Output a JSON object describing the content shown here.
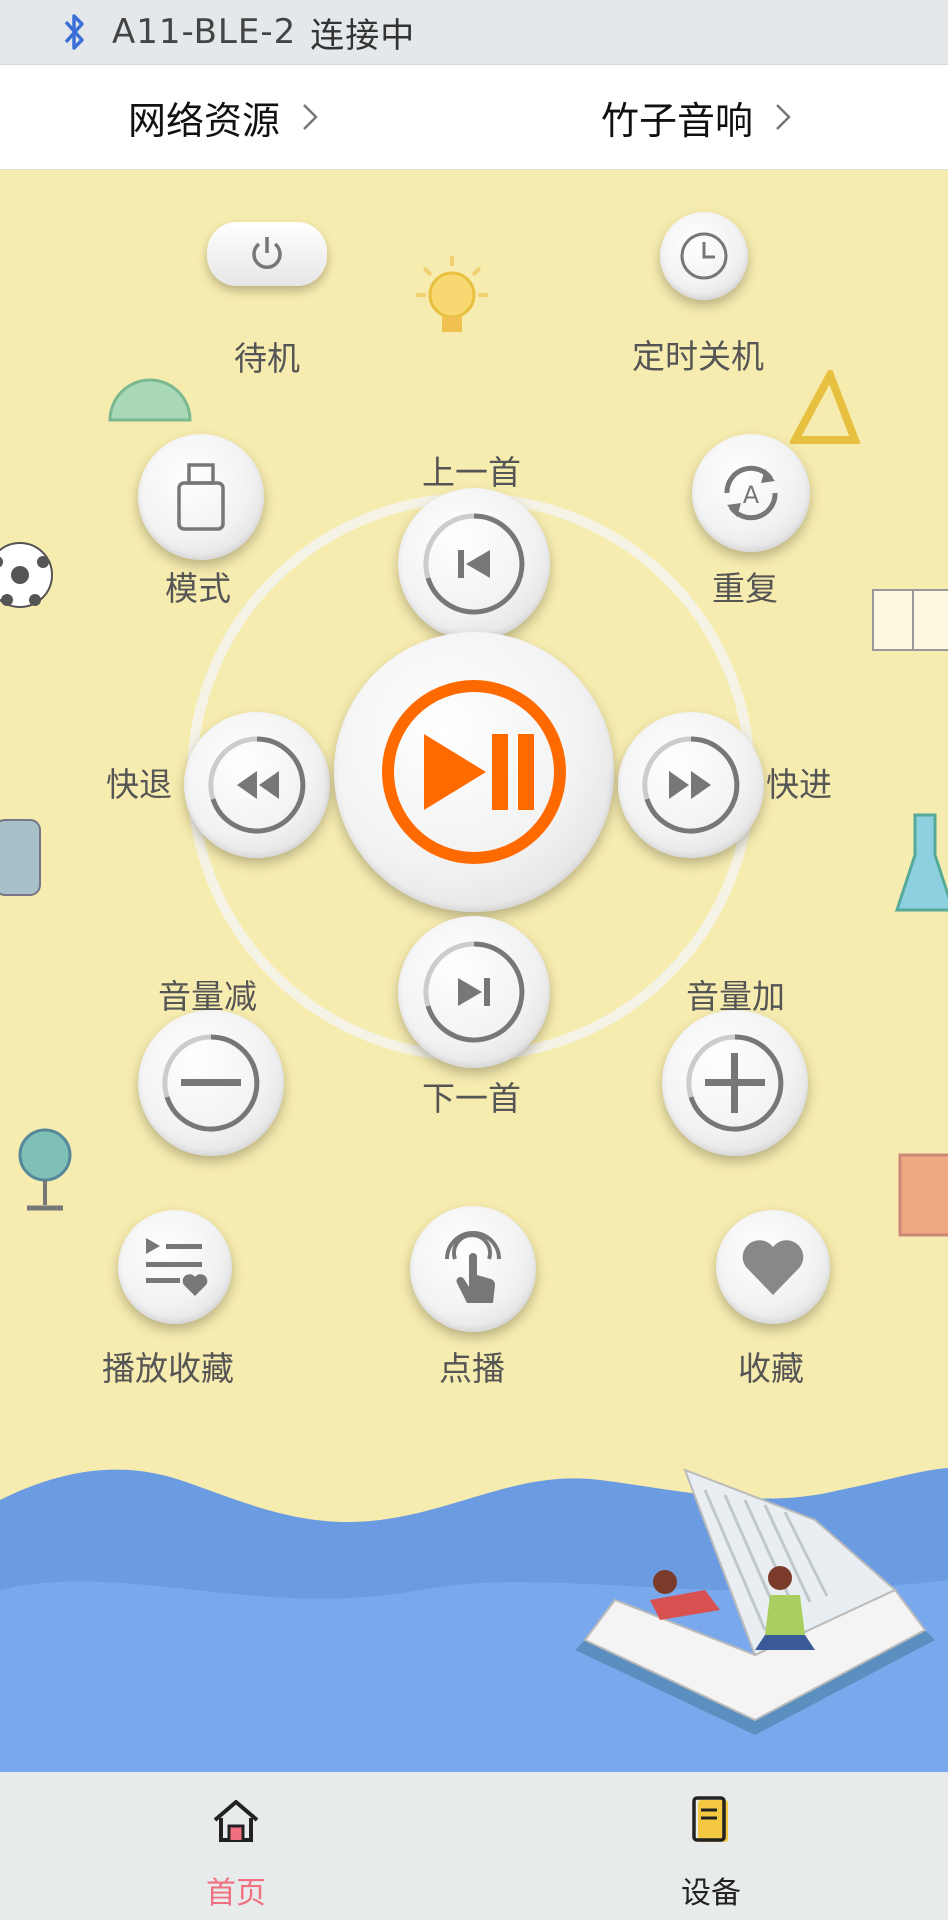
{
  "status_bar": {
    "device_name": "A11-BLE-2",
    "connection_status": "连接中"
  },
  "nav": {
    "left_link": "网络资源",
    "right_link": "竹子音响"
  },
  "controls": {
    "standby": "待机",
    "sleep_timer": "定时关机",
    "mode": "模式",
    "previous": "上一首",
    "repeat": "重复",
    "rewind": "快退",
    "fast_forward": "快进",
    "volume_down": "音量减",
    "volume_up": "音量加",
    "next": "下一首",
    "play_favorites": "播放收藏",
    "on_demand": "点播",
    "favorite": "收藏"
  },
  "tabs": [
    {
      "label": "首页",
      "icon": "home-icon",
      "active": true
    },
    {
      "label": "设备",
      "icon": "device-icon",
      "active": false
    }
  ],
  "colors": {
    "accent_orange": "#ff6a00",
    "active_tab": "#f07080",
    "bluetooth": "#3a6fd8"
  }
}
